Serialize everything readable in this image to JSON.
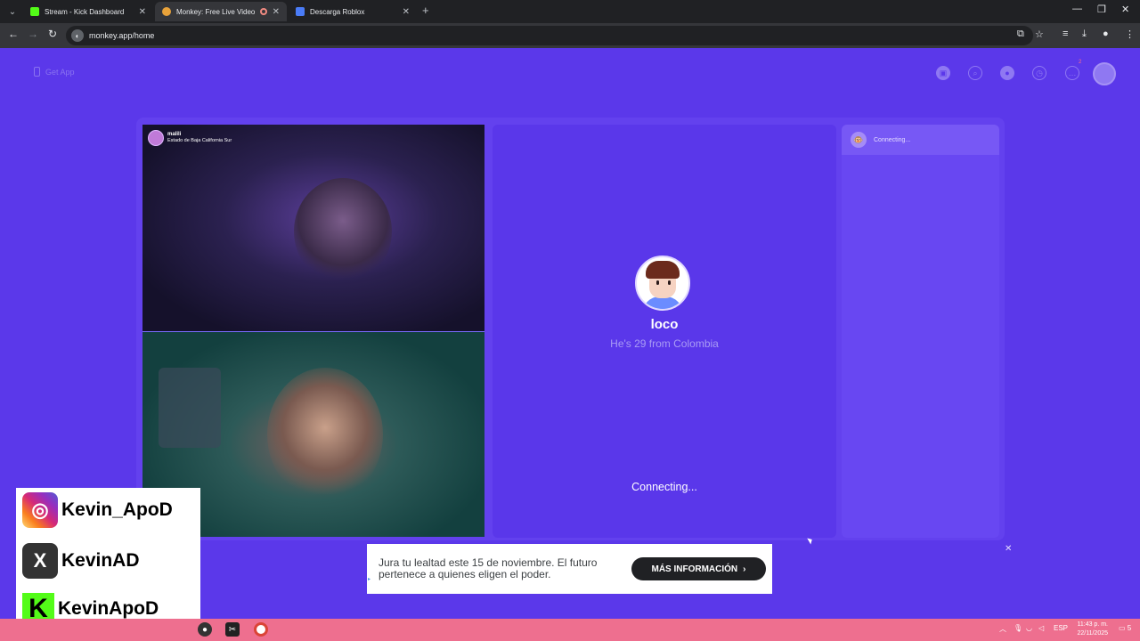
{
  "browser": {
    "tabs": [
      {
        "title": "Stream - Kick Dashboard",
        "favicon_color": "#53fc18"
      },
      {
        "title": "Monkey: Free Live Video Cl",
        "favicon_color": "#e8a23a",
        "active": true
      },
      {
        "title": "Descarga Roblox",
        "favicon_color": "#4a7cf7"
      }
    ],
    "url": "monkey.app/home"
  },
  "header": {
    "get_app": "Get App",
    "notification_count": "2"
  },
  "video": {
    "remote_name": "malili",
    "remote_location": "Estado de Baja California Sur"
  },
  "match": {
    "name": "loco",
    "subtitle": "He's 29 from Colombia",
    "status": "Connecting..."
  },
  "chat": {
    "status": "Connecting..."
  },
  "ad": {
    "text": "Jura tu lealtad este 15 de noviembre. El futuro pertenece a quienes eligen el poder.",
    "button": "MÁS INFORMACIÓN",
    "close": "✕"
  },
  "socials": {
    "instagram": "Kevin_ApoD",
    "x": "KevinAD",
    "kick": "KevinApoD"
  },
  "taskbar": {
    "lang": "ESP",
    "time": "11:43 p. m.",
    "date": "22/11/2025",
    "notif": "5"
  },
  "colors": {
    "page_bg": "#5b38ea",
    "panel_bg": "#5a37ea",
    "taskbar": "#ee6f8f"
  }
}
